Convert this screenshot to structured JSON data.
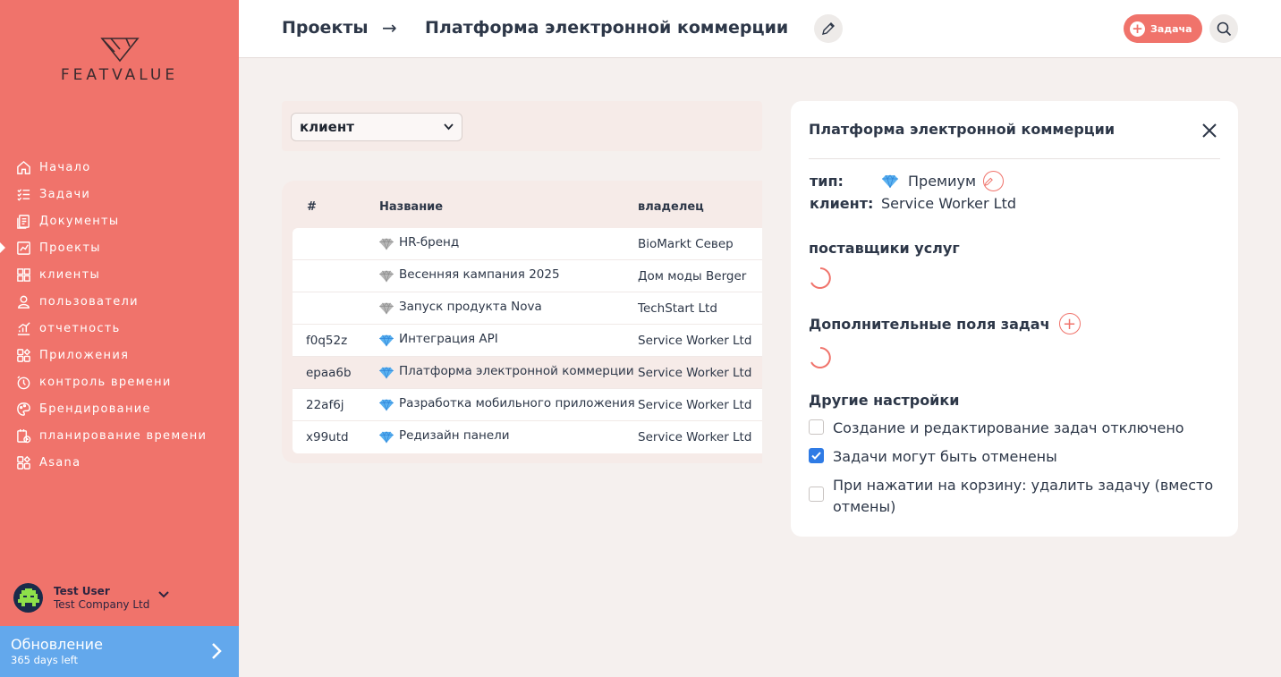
{
  "brand": {
    "name": "FEATVALUE",
    "accent": "#f0736b",
    "update_color": "#63a8ec"
  },
  "sidebar": {
    "items": [
      {
        "label": "Начало",
        "icon": "home-icon"
      },
      {
        "label": "Задачи",
        "icon": "tasks-icon"
      },
      {
        "label": "Документы",
        "icon": "documents-icon"
      },
      {
        "label": "Проекты",
        "icon": "projects-icon",
        "active": true
      },
      {
        "label": "клиенты",
        "icon": "clients-icon"
      },
      {
        "label": "пользователи",
        "icon": "user-icon"
      },
      {
        "label": "отчетность",
        "icon": "reports-icon"
      },
      {
        "label": "Приложения",
        "icon": "apps-icon"
      },
      {
        "label": "контроль времени",
        "icon": "timer-icon"
      },
      {
        "label": "Брендирование",
        "icon": "branding-icon"
      },
      {
        "label": "планирование времени",
        "icon": "calendar-clock-icon"
      },
      {
        "label": "Asana",
        "icon": "apps-icon"
      }
    ],
    "user": {
      "name": "Test User",
      "company": "Test Company Ltd"
    },
    "update": {
      "title": "Обновление",
      "subtitle": "365 days left"
    }
  },
  "header": {
    "breadcrumb_root": "Проекты",
    "breadcrumb_arrow": "→",
    "breadcrumb_current": "Платформа электронной коммерции",
    "task_button_label": "Задача"
  },
  "filter": {
    "selected": "клиент"
  },
  "table": {
    "headers": {
      "id": "#",
      "name": "Название",
      "owner": "владелец"
    },
    "rows": [
      {
        "id": "",
        "name": "HR-бренд",
        "owner": "BioMarkt Север",
        "tier": "silver"
      },
      {
        "id": "",
        "name": "Весенняя кампания 2025",
        "owner": "Дом моды Berger",
        "tier": "silver"
      },
      {
        "id": "",
        "name": "Запуск продукта Nova",
        "owner": "TechStart Ltd",
        "tier": "silver"
      },
      {
        "id": "f0q52z",
        "name": "Интеграция API",
        "owner": "Service Worker Ltd",
        "tier": "premium"
      },
      {
        "id": "epaa6b",
        "name": "Платформа электронной коммерции",
        "owner": "Service Worker Ltd",
        "tier": "premium",
        "selected": true
      },
      {
        "id": "22af6j",
        "name": "Разработка мобильного приложения",
        "owner": "Service Worker Ltd",
        "tier": "premium"
      },
      {
        "id": "x99utd",
        "name": "Редизайн панели",
        "owner": "Service Worker Ltd",
        "tier": "premium"
      }
    ]
  },
  "panel": {
    "title": "Платформа электронной коммерции",
    "type_label": "тип:",
    "type_value": "Премиум",
    "client_label": "клиент:",
    "client_value": "Service Worker Ltd",
    "providers_title": "поставщики услуг",
    "extra_fields_title": "Дополнительные поля задач",
    "other_settings_title": "Другие настройки",
    "settings": [
      {
        "label": "Создание и редактирование задач отключено",
        "checked": false
      },
      {
        "label": "Задачи могут быть отменены",
        "checked": true
      },
      {
        "label": "При нажатии на корзину: удалить задачу (вместо отмены)",
        "checked": false
      }
    ]
  }
}
